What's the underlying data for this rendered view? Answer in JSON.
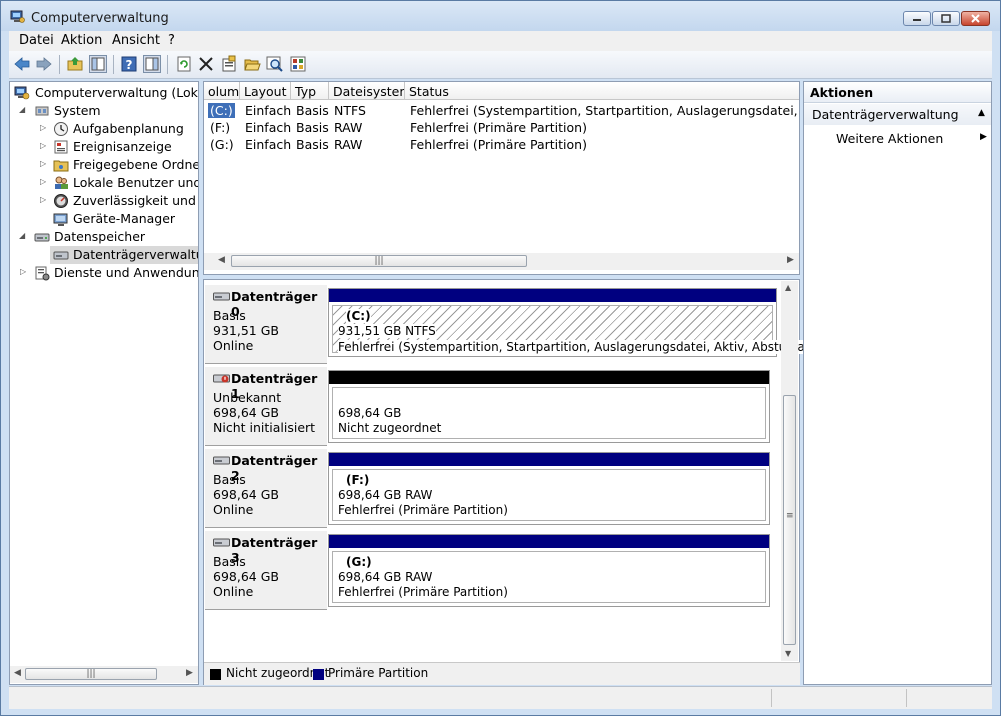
{
  "window": {
    "title": "Computerverwaltung"
  },
  "menu": [
    "Datei",
    "Aktion",
    "Ansicht",
    "?"
  ],
  "toolbar": {
    "icons": [
      "back-arrow-icon",
      "forward-arrow-icon",
      "up-folder-icon",
      "show-hide-tree-icon",
      "help-icon",
      "show-hide-action-pane-icon",
      "refresh-icon",
      "delete-icon",
      "properties-icon",
      "open-folder-icon",
      "search-icon",
      "settings-icon"
    ]
  },
  "tree": {
    "root": "Computerverwaltung (Lokal)",
    "items": [
      {
        "label": "System",
        "level": 1,
        "expanded": true
      },
      {
        "label": "Aufgabenplanung",
        "level": 2
      },
      {
        "label": "Ereignisanzeige",
        "level": 2
      },
      {
        "label": "Freigegebene Ordner",
        "level": 2
      },
      {
        "label": "Lokale Benutzer und Gru",
        "level": 2
      },
      {
        "label": "Zuverlässigkeit und Leis",
        "level": 2
      },
      {
        "label": "Geräte-Manager",
        "level": 2
      },
      {
        "label": "Datenspeicher",
        "level": 1,
        "expanded": true
      },
      {
        "label": "Datenträgerverwaltung",
        "level": 2,
        "selected": true
      },
      {
        "label": "Dienste und Anwendungen",
        "level": 1
      }
    ]
  },
  "volumes": {
    "headers": [
      "olume",
      "Layout",
      "Typ",
      "Dateisystem",
      "Status"
    ],
    "rows": [
      [
        "(C:)",
        "Einfach",
        "Basis",
        "NTFS",
        "Fehlerfrei (Systempartition, Startpartition, Auslagerungsdatei, Aktiv, Abstu"
      ],
      [
        "(F:)",
        "Einfach",
        "Basis",
        "RAW",
        "Fehlerfrei (Primäre Partition)"
      ],
      [
        "(G:)",
        "Einfach",
        "Basis",
        "RAW",
        "Fehlerfrei (Primäre Partition)"
      ]
    ]
  },
  "disks": [
    {
      "name": "Datenträger 0",
      "type": "Basis",
      "size": "931,51 GB",
      "state": "Online",
      "partition": {
        "label": "(C:)",
        "info": "931,51 GB NTFS",
        "status": "Fehlerfrei (Systempartition, Startpartition, Auslagerungsdatei, Aktiv, Absturzabbild,",
        "color": "#000080"
      }
    },
    {
      "name": "Datenträger 1",
      "type": "Unbekannt",
      "size": "698,64 GB",
      "state": "Nicht initialisiert",
      "partition": {
        "label": "",
        "info": "698,64 GB",
        "status": "Nicht zugeordnet",
        "color": "#000000"
      }
    },
    {
      "name": "Datenträger 2",
      "type": "Basis",
      "size": "698,64 GB",
      "state": "Online",
      "partition": {
        "label": "(F:)",
        "info": "698,64 GB RAW",
        "status": "Fehlerfrei (Primäre Partition)",
        "color": "#000080"
      }
    },
    {
      "name": "Datenträger 3",
      "type": "Basis",
      "size": "698,64 GB",
      "state": "Online",
      "partition": {
        "label": "(G:)",
        "info": "698,64 GB RAW",
        "status": "Fehlerfrei (Primäre Partition)",
        "color": "#000080"
      }
    }
  ],
  "legend": [
    {
      "label": "Nicht zugeordnet",
      "color": "#000000"
    },
    {
      "label": "Primäre Partition",
      "color": "#000080"
    }
  ],
  "actions": {
    "title": "Aktionen",
    "section": "Datenträgerverwaltung",
    "more": "Weitere Aktionen"
  }
}
